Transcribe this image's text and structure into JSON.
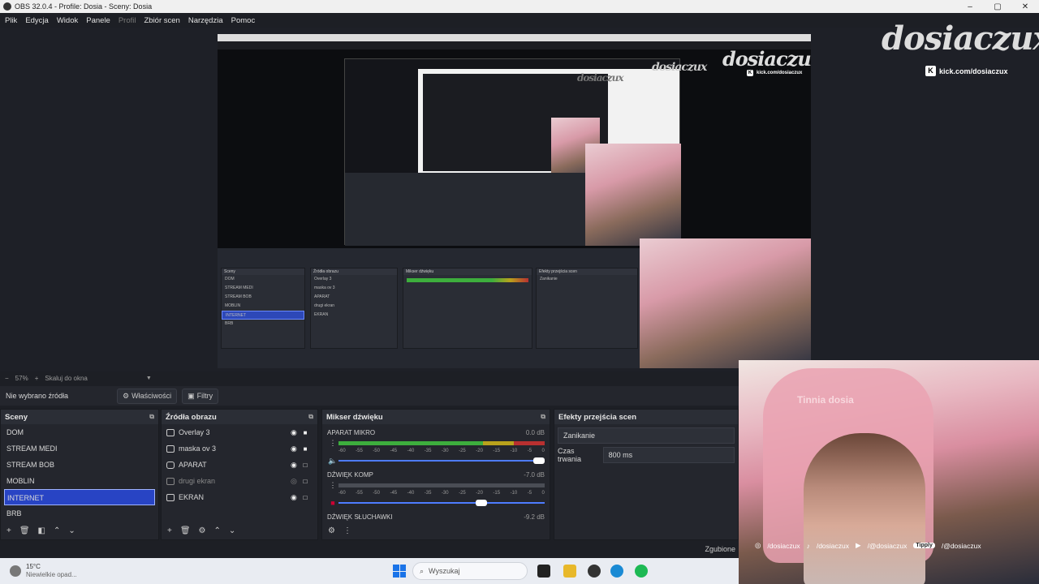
{
  "window": {
    "title": "OBS 32.0.4 - Profile: Dosia - Sceny: Dosia",
    "min": "–",
    "max": "▢",
    "close": "✕"
  },
  "menu": [
    "Plik",
    "Edycja",
    "Widok",
    "Panele",
    "Profil",
    "Zbiór scen",
    "Narzędzia",
    "Pomoc"
  ],
  "overlay": {
    "logo": "dosiaczux",
    "kick_url": "kick.com/dosiaczux",
    "kick_k": "K"
  },
  "zoom": {
    "minus": "−",
    "value": "57%",
    "plus": "+",
    "mode": "Skaluj do okna",
    "chevron": "▼"
  },
  "source_bar": {
    "no_source": "Nie wybrano źródła",
    "properties": "Właściwości",
    "filters": "Filtry"
  },
  "scenes": {
    "title": "Sceny",
    "items": [
      "DOM",
      "STREAM MEDI",
      "STREAM BOB",
      "MOBLIN",
      "INTERNET",
      "BRB"
    ],
    "selected_index": 4
  },
  "sources": {
    "title": "Źródła obrazu",
    "items": [
      {
        "name": "Overlay 3",
        "icon": "scene-icon",
        "visible": true,
        "locked": true
      },
      {
        "name": "maska ov 3",
        "icon": "scene-icon",
        "visible": true,
        "locked": true
      },
      {
        "name": "APARAT",
        "icon": "camera-icon",
        "visible": true,
        "locked": false
      },
      {
        "name": "drugi ekran",
        "icon": "display-icon",
        "visible": false,
        "locked": false
      },
      {
        "name": "EKRAN",
        "icon": "display-icon",
        "visible": true,
        "locked": false
      }
    ]
  },
  "mixer": {
    "title": "Mikser dźwięku",
    "scale": [
      "-60",
      "-55",
      "-50",
      "-45",
      "-40",
      "-35",
      "-30",
      "-25",
      "-20",
      "-15",
      "-10",
      "-5",
      "0"
    ],
    "channels": [
      {
        "name": "APARAT MIKRO",
        "db": "0.0 dB",
        "level": 0.93,
        "fader": 1.0
      },
      {
        "name": "DŹWIĘK KOMP",
        "db": "-7.0 dB",
        "level": 0.0,
        "fader": 0.72
      },
      {
        "name": "DŹWIĘK SŁUCHAWKI",
        "db": "-9.2 dB"
      }
    ]
  },
  "transitions": {
    "title": "Efekty przejścia scen",
    "selected": "Zanikanie",
    "duration_label": "Czas trwania",
    "duration": "800 ms"
  },
  "status": {
    "text": "Zgubione"
  },
  "webcam": {
    "chair_text": "Tinnia dosia",
    "socials": [
      "/dosiaczux",
      "/dosiaczux",
      "/@dosiaczux",
      "/@dosiaczux"
    ],
    "tipply": "Tipply"
  },
  "taskbar": {
    "temp": "15°C",
    "weather": "Niewielkie opad...",
    "search_placeholder": "Wyszukaj"
  },
  "colors": {
    "accent": "#2844c4",
    "meter_green": "#3dae3d",
    "meter_yellow": "#b9a21c",
    "meter_red": "#b83030"
  }
}
